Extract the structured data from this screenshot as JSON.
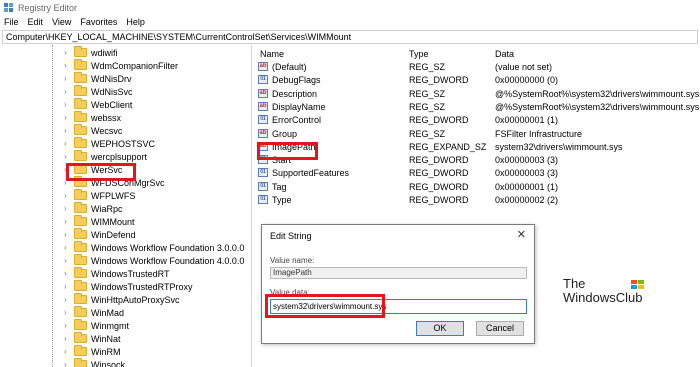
{
  "window": {
    "title": "Registry Editor"
  },
  "menu": [
    "File",
    "Edit",
    "View",
    "Favorites",
    "Help"
  ],
  "address": "Computer\\HKEY_LOCAL_MACHINE\\SYSTEM\\CurrentControlSet\\Services\\WIMMount",
  "tree": {
    "items": [
      "wdiwifi",
      "WdmCompanionFilter",
      "WdNisDrv",
      "WdNisSvc",
      "WebClient",
      "webssx",
      "Wecsvc",
      "WEPHOSTSVC",
      "wercplsupport",
      "WerSvc",
      "WFDSConMgrSvc",
      "WFPLWFS",
      "WiaRpc",
      "WIMMount",
      "WinDefend",
      "Windows Workflow Foundation 3.0.0.0",
      "Windows Workflow Foundation 4.0.0.0",
      "WindowsTrustedRT",
      "WindowsTrustedRTProxy",
      "WinHttpAutoProxySvc",
      "WinMad",
      "Winmgmt",
      "WinNat",
      "WinRM",
      "Winsock"
    ],
    "selected": "WIMMount"
  },
  "list": {
    "headers": {
      "name": "Name",
      "type": "Type",
      "data": "Data"
    },
    "rows": [
      {
        "name": "(Default)",
        "type": "REG_SZ",
        "data": "(value not set)",
        "icon": "string-value-icon"
      },
      {
        "name": "DebugFlags",
        "type": "REG_DWORD",
        "data": "0x00000000 (0)",
        "icon": "binary-value-icon"
      },
      {
        "name": "Description",
        "type": "REG_SZ",
        "data": "@%SystemRoot%\\system32\\drivers\\wimmount.sys...",
        "icon": "string-value-icon"
      },
      {
        "name": "DisplayName",
        "type": "REG_SZ",
        "data": "@%SystemRoot%\\system32\\drivers\\wimmount.sys...",
        "icon": "string-value-icon"
      },
      {
        "name": "ErrorControl",
        "type": "REG_DWORD",
        "data": "0x00000001 (1)",
        "icon": "binary-value-icon"
      },
      {
        "name": "Group",
        "type": "REG_SZ",
        "data": "FSFilter Infrastructure",
        "icon": "string-value-icon"
      },
      {
        "name": "ImagePath",
        "type": "REG_EXPAND_SZ",
        "data": "system32\\drivers\\wimmount.sys",
        "icon": "string-value-icon"
      },
      {
        "name": "Start",
        "type": "REG_DWORD",
        "data": "0x00000003 (3)",
        "icon": "binary-value-icon"
      },
      {
        "name": "SupportedFeatures",
        "type": "REG_DWORD",
        "data": "0x00000003 (3)",
        "icon": "binary-value-icon"
      },
      {
        "name": "Tag",
        "type": "REG_DWORD",
        "data": "0x00000001 (1)",
        "icon": "binary-value-icon"
      },
      {
        "name": "Type",
        "type": "REG_DWORD",
        "data": "0x00000002 (2)",
        "icon": "binary-value-icon"
      }
    ]
  },
  "dialog": {
    "title": "Edit String",
    "close": "✕",
    "value_name_label": "Value name:",
    "value_name": "ImagePath",
    "value_data_label": "Value data:",
    "value_data": "system32\\drivers\\wimmount.sys",
    "ok": "OK",
    "cancel": "Cancel"
  },
  "watermark": {
    "line1": "The",
    "line2": "WindowsClub"
  },
  "colors": {
    "highlight": "#e2161b",
    "folder": "#f5cd5b",
    "focus": "#3a78d4"
  }
}
